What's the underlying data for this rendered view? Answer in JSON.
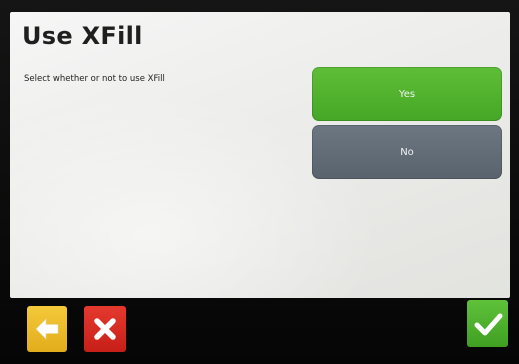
{
  "screen": {
    "title": "Use XFill",
    "instruction": "Select whether or not to use XFill"
  },
  "options": [
    {
      "label": "Yes",
      "selected": true,
      "color": "#4fb22c"
    },
    {
      "label": "No",
      "selected": false,
      "color": "#636d77"
    }
  ],
  "hardware_buttons": {
    "back": {
      "icon": "arrow-left-icon",
      "color": "#eebb2a"
    },
    "cancel": {
      "icon": "x-icon",
      "color": "#d62b22"
    },
    "confirm": {
      "icon": "checkmark-icon",
      "color": "#4cae2b"
    }
  }
}
